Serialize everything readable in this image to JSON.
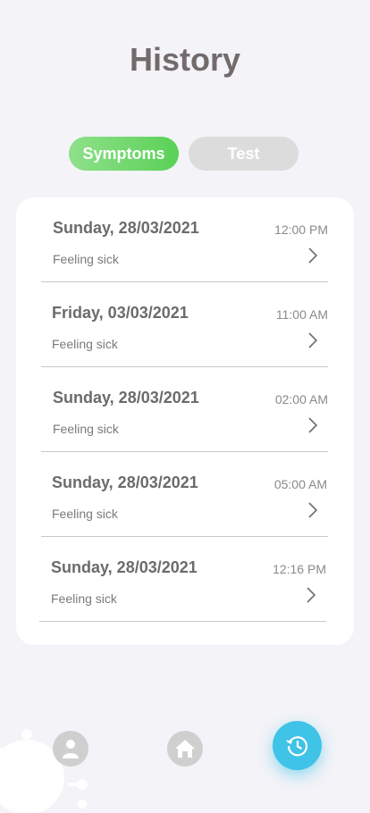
{
  "page": {
    "title": "History"
  },
  "tabs": [
    {
      "label": "Symptoms",
      "active": true
    },
    {
      "label": "Test",
      "active": false
    }
  ],
  "history": [
    {
      "date": "Sunday, 28/03/2021",
      "time": "12:00 PM",
      "note": "Feeling sick"
    },
    {
      "date": "Friday, 03/03/2021",
      "time": "11:00 AM",
      "note": "Feeling sick"
    },
    {
      "date": "Sunday, 28/03/2021",
      "time": "02:00 AM",
      "note": "Feeling sick"
    },
    {
      "date": "Sunday, 28/03/2021",
      "time": "05:00 AM",
      "note": "Feeling sick"
    },
    {
      "date": "Sunday, 28/03/2021",
      "time": "12:16 PM",
      "note": "Feeling sick"
    }
  ],
  "nav": {
    "items": [
      {
        "icon": "person-icon",
        "active": false
      },
      {
        "icon": "home-icon",
        "active": false
      },
      {
        "icon": "history-icon",
        "active": true
      }
    ]
  },
  "colors": {
    "background": "#f3f3f8",
    "accent_green": "#5ad157",
    "accent_blue": "#3fc3e6",
    "title": "#736b6b",
    "inactive": "#dcdcdc"
  }
}
